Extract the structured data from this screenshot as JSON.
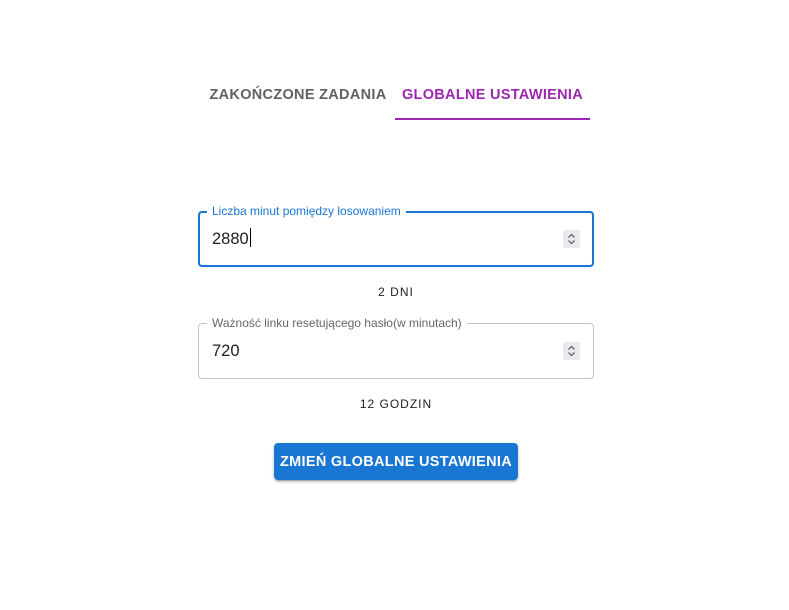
{
  "tabs": [
    {
      "label": "ZAKOŃCZONE ZADANIA",
      "active": false
    },
    {
      "label": "GLOBALNE USTAWIENIA",
      "active": true
    }
  ],
  "accent_colors": {
    "tab_active": "#9c27b0",
    "focus": "#1976d2",
    "button": "#1976d2"
  },
  "form": {
    "draw_interval": {
      "label": "Liczba minut pomiędzy losowaniem",
      "value": "2880",
      "focused": true,
      "helper": "2 DNI"
    },
    "reset_link_validity": {
      "label": "Ważność linku resetującego hasło(w minutach)",
      "value": "720",
      "focused": false,
      "helper": "12 GODZIN"
    },
    "submit_label": "ZMIEŃ GLOBALNE USTAWIENIA"
  }
}
